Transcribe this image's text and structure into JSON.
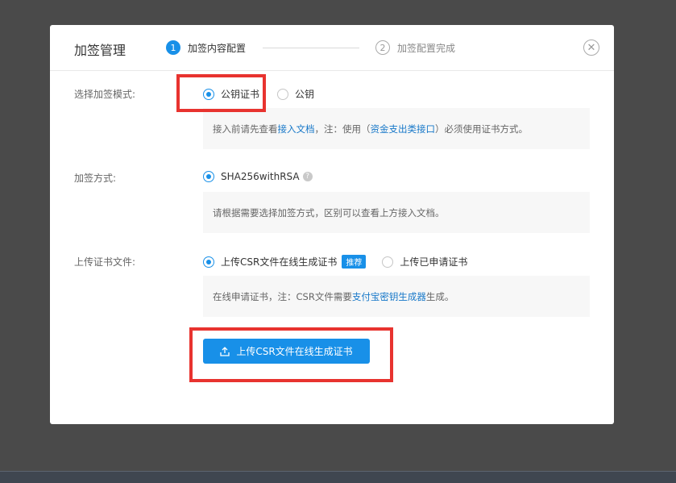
{
  "modal": {
    "title": "加签管理",
    "close_icon": "close-circle-icon",
    "steps": [
      {
        "number": "1",
        "label": "加签内容配置",
        "active": true
      },
      {
        "number": "2",
        "label": "加签配置完成",
        "active": false
      }
    ]
  },
  "mode": {
    "label": "选择加签模式:",
    "options": [
      {
        "label": "公钥证书",
        "selected": true
      },
      {
        "label": "公钥",
        "selected": false
      }
    ],
    "info": {
      "prefix": "接入前请先查看",
      "link1": "接入文档",
      "middle": "，注：使用（",
      "link2": "资金支出类接口",
      "suffix": "）必须使用证书方式。"
    }
  },
  "method": {
    "label": "加签方式:",
    "option": "SHA256withRSA",
    "help_icon": "?",
    "info": "请根据需要选择加签方式，区别可以查看上方接入文档。"
  },
  "upload": {
    "label": "上传证书文件:",
    "options": [
      {
        "label": "上传CSR文件在线生成证书",
        "selected": true,
        "tag": "推荐"
      },
      {
        "label": "上传已申请证书",
        "selected": false
      }
    ],
    "info": {
      "prefix": "在线申请证书，注：CSR文件需要",
      "link": "支付宝密钥生成器",
      "suffix": "生成。"
    },
    "button_label": "上传CSR文件在线生成证书",
    "button_icon": "upload-icon"
  },
  "colors": {
    "primary": "#1890e8",
    "highlight": "#e8332f",
    "overlay": "#4a4a4a"
  }
}
